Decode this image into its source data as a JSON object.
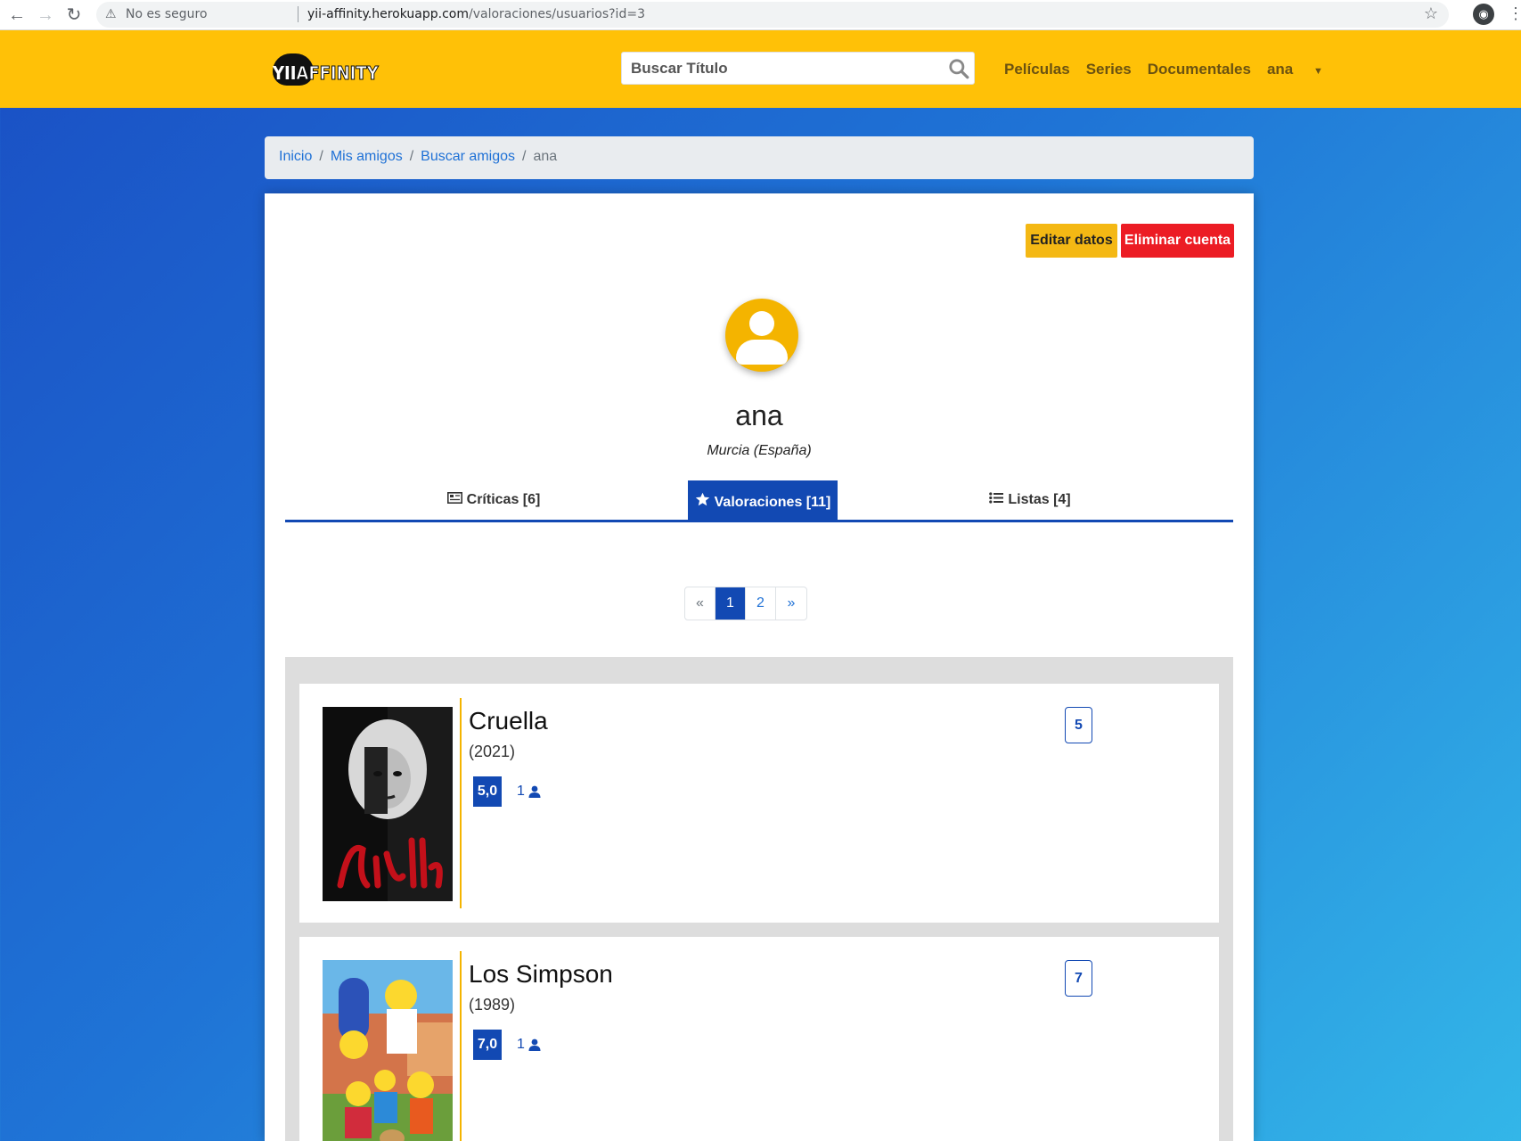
{
  "browser": {
    "security_label": "No es seguro",
    "url_host": "yii-affinity.herokuapp.com",
    "url_path": "/valoraciones/usuarios?id=3",
    "profile_letter": "◉"
  },
  "navbar": {
    "logo_text_a": "YII",
    "logo_text_b": "AFFINITY",
    "search_placeholder": "Buscar Título",
    "links": {
      "peliculas": "Películas",
      "series": "Series",
      "documentales": "Documentales",
      "user": "ana"
    }
  },
  "breadcrumb": {
    "inicio": "Inicio",
    "mis_amigos": "Mis amigos",
    "buscar_amigos": "Buscar amigos",
    "current": "ana",
    "separator": "/"
  },
  "profile": {
    "edit_button": "Editar datos",
    "delete_button": "Eliminar cuenta",
    "username": "ana",
    "location": "Murcia (España)"
  },
  "tabs": {
    "criticas": "Críticas [6]",
    "valoraciones": "Valoraciones [11]",
    "listas": "Listas [4]"
  },
  "pagination": {
    "prev": "«",
    "page1": "1",
    "page2": "2",
    "next": "»"
  },
  "items": [
    {
      "title": "Cruella",
      "year": "(2021)",
      "score": "5,0",
      "votes": "1",
      "my_rating": "5"
    },
    {
      "title": "Los Simpson",
      "year": "(1989)",
      "score": "7,0",
      "votes": "1",
      "my_rating": "7"
    }
  ],
  "colors": {
    "navbar": "#ffc107",
    "primary": "#1249b3",
    "danger": "#ec1c24",
    "accent": "#f4b400"
  }
}
